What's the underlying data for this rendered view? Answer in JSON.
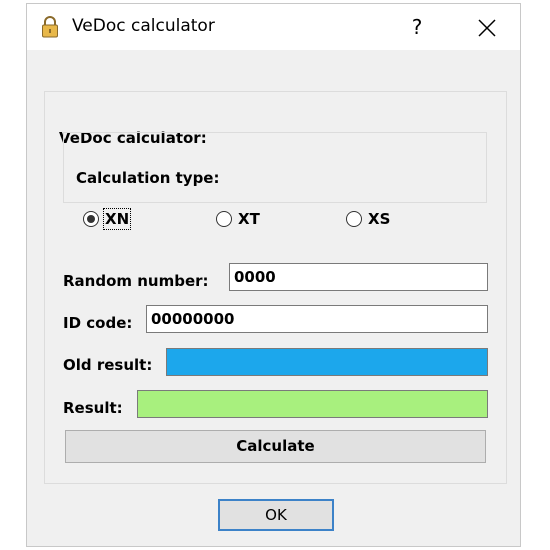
{
  "window": {
    "title": "VeDoc calculator",
    "help_label": "?",
    "title_icon": "padlock-icon",
    "close_icon": "close-icon"
  },
  "main_group": {
    "label": "VeDoc calculator:"
  },
  "calc_type": {
    "label": "Calculation type:",
    "options": [
      {
        "label": "XN",
        "selected": true
      },
      {
        "label": "XT",
        "selected": false
      },
      {
        "label": "XS",
        "selected": false
      }
    ]
  },
  "fields": {
    "random_number": {
      "label": "Random number:",
      "value": "0000"
    },
    "id_code": {
      "label": "ID code:",
      "value": "00000000"
    },
    "old_result": {
      "label": "Old result:",
      "color": "#1ca7ec"
    },
    "result": {
      "label": "Result:",
      "color": "#a8f07e"
    }
  },
  "buttons": {
    "calculate": "Calculate",
    "ok": "OK"
  },
  "colors": {
    "old_result_fill": "#1ca7ec",
    "result_fill": "#a8f07e",
    "ok_border": "#3c82c8",
    "dialog_bg": "#f0f0f0"
  }
}
